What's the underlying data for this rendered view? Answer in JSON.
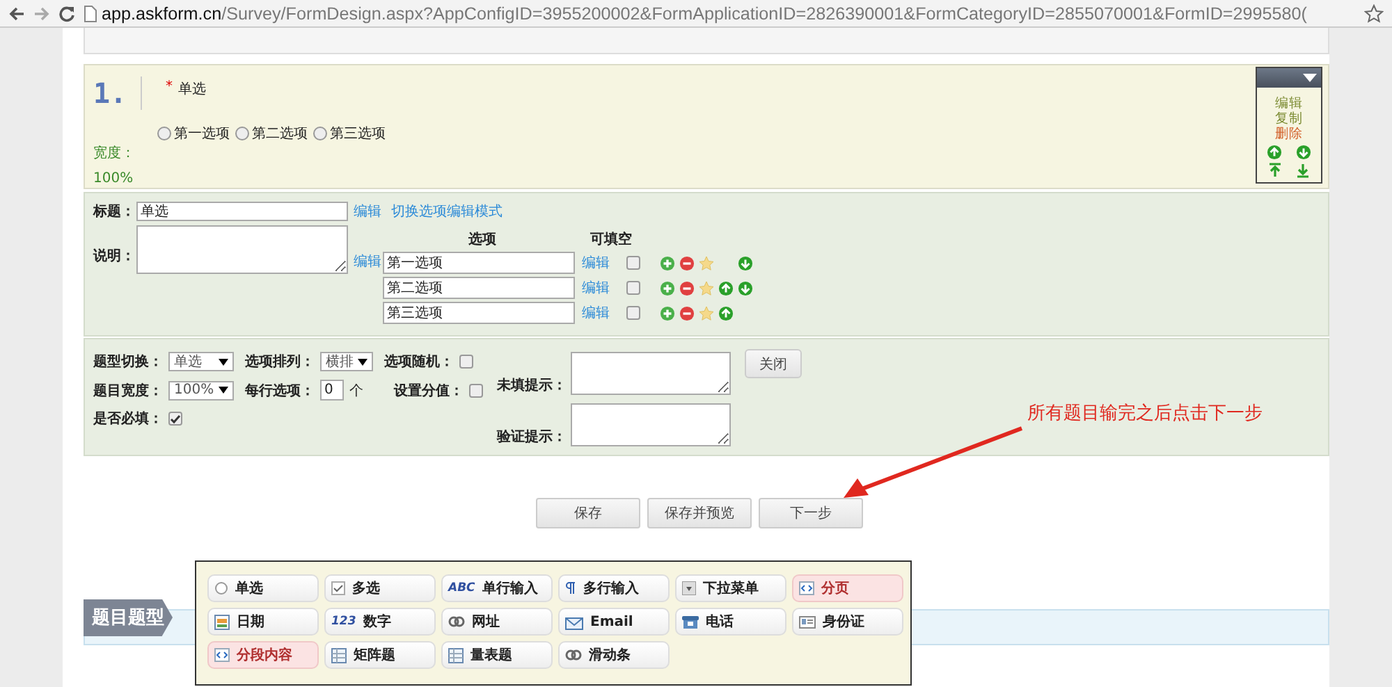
{
  "browser": {
    "url_host": "app.askform.cn",
    "url_path": "/Survey/FormDesign.aspx?AppConfigID=3955200002&FormApplicationID=2826390001&FormCategoryID=2855070001&FormID=2995580("
  },
  "question": {
    "number": "1.",
    "required_mark": "*",
    "title": "单选",
    "width_label": "宽度：",
    "width_value": "100%",
    "options": [
      {
        "label": "第一选项",
        "selected": false
      },
      {
        "label": "第二选项",
        "selected": false
      },
      {
        "label": "第三选项",
        "selected": false
      }
    ],
    "actions": [
      {
        "label": "编辑",
        "kind": "normal"
      },
      {
        "label": "复制",
        "kind": "normal"
      },
      {
        "label": "删除",
        "kind": "danger"
      }
    ]
  },
  "editor": {
    "title_label": "标题：",
    "title_value": "单选",
    "title_edit": "编辑",
    "switch_mode": "切换选项编辑模式",
    "desc_label": "说明：",
    "desc_edit": "编辑",
    "options_header": "选项",
    "fillable_header": "可填空",
    "options": [
      {
        "value": "第一选项",
        "edit": "编辑",
        "fillable": false,
        "up": false,
        "down": true
      },
      {
        "value": "第二选项",
        "edit": "编辑",
        "fillable": false,
        "up": true,
        "down": true
      },
      {
        "value": "第三选项",
        "edit": "编辑",
        "fillable": false,
        "up": true,
        "down": false
      }
    ]
  },
  "settings": {
    "type_label": "题型切换：",
    "type_value": "单选",
    "layout_label": "选项排列：",
    "layout_value": "横排",
    "random_label": "选项随机：",
    "random_checked": false,
    "width_label": "题目宽度：",
    "width_value": "100%",
    "per_row_label": "每行选项：",
    "per_row_value": "0",
    "per_row_unit": "个",
    "score_label": "设置分值：",
    "score_checked": false,
    "required_label": "是否必填：",
    "required_checked": true,
    "empty_hint_label": "未填提示：",
    "verify_hint_label": "验证提示：",
    "close": "关闭"
  },
  "buttons": [
    "保存",
    "保存并预览",
    "下一步"
  ],
  "annotation": "所有题目输完之后点击下一步",
  "footer_tab": "题目题型",
  "palette": [
    {
      "label": "单选",
      "kind": "radio",
      "highlighted": false
    },
    {
      "label": "多选",
      "kind": "check",
      "highlighted": false
    },
    {
      "label": "单行输入",
      "kind": "text",
      "icon_text": "ABC",
      "highlighted": false
    },
    {
      "label": "多行输入",
      "kind": "para",
      "highlighted": false
    },
    {
      "label": "下拉菜单",
      "kind": "dropdown",
      "highlighted": false
    },
    {
      "label": "分页",
      "kind": "code",
      "highlighted": true
    },
    {
      "label": "日期",
      "kind": "calendar",
      "highlighted": false
    },
    {
      "label": "数字",
      "kind": "text",
      "icon_text": "123",
      "highlighted": false
    },
    {
      "label": "网址",
      "kind": "link",
      "highlighted": false
    },
    {
      "label": "Email",
      "kind": "mail",
      "highlighted": false
    },
    {
      "label": "电话",
      "kind": "phone",
      "highlighted": false
    },
    {
      "label": "身份证",
      "kind": "card",
      "highlighted": false
    },
    {
      "label": "分段内容",
      "kind": "code",
      "highlighted": true
    },
    {
      "label": "矩阵题",
      "kind": "grid",
      "highlighted": false
    },
    {
      "label": "量表题",
      "kind": "grid",
      "highlighted": false
    },
    {
      "label": "滑动条",
      "kind": "link",
      "highlighted": false
    }
  ]
}
